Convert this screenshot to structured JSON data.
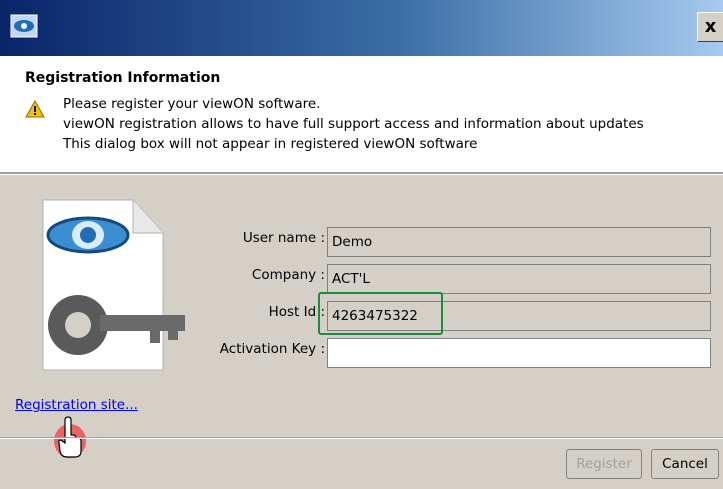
{
  "titlebar": {
    "close_label": "x"
  },
  "header": {
    "title": "Registration Information",
    "lines": [
      "Please register your viewON software.",
      "viewON registration allows to have full support access and information about updates",
      "This dialog box will not appear in registered viewON software"
    ]
  },
  "form": {
    "user_name_label": "User name :",
    "user_name_value": "Demo",
    "company_label": "Company :",
    "company_value": "ACT'L",
    "host_id_label": "Host Id :",
    "host_id_value": "4263475322",
    "activation_key_label": "Activation Key :",
    "activation_key_value": ""
  },
  "link_text": "Registration site...",
  "buttons": {
    "register": "Register",
    "cancel": "Cancel"
  }
}
